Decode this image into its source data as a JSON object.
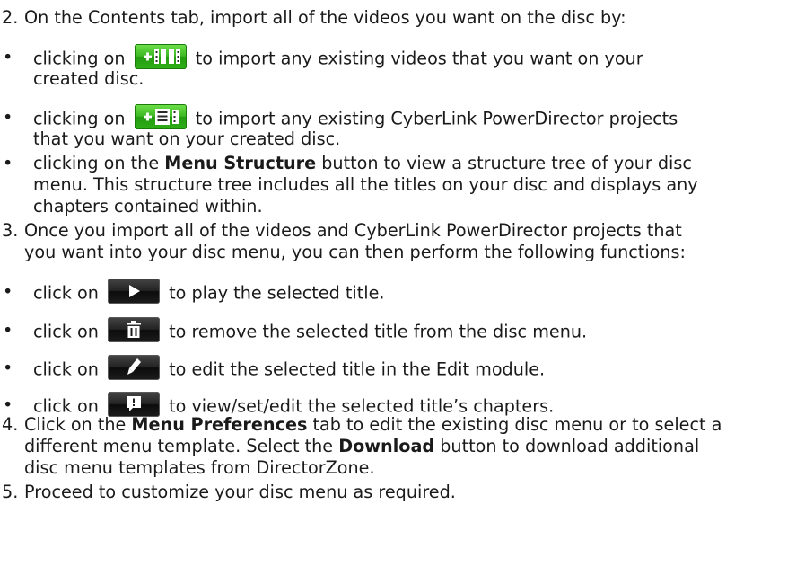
{
  "steps": {
    "step2": {
      "number": "2.",
      "text": "On the Contents tab, import all of the videos you want on the disc by:"
    },
    "bullets_import": [
      {
        "lead": "clicking on",
        "icon": "add-video-icon",
        "line1": "to import any existing videos that you want on your",
        "line2": "created disc."
      },
      {
        "lead": "clicking on",
        "icon": "add-project-icon",
        "line1": "to import any existing CyberLink PowerDirector projects",
        "line2": "that you want on your created disc."
      }
    ],
    "bullet_menu_structure": {
      "lead": "clicking on the ",
      "bold": "Menu Structure",
      "line1_rest": " button to view a structure tree of your disc",
      "line2": "menu. This structure tree includes all the titles on your disc and displays any",
      "line3": "chapters contained within."
    },
    "step3": {
      "number": "3.",
      "line1": "Once you import all of the videos and CyberLink PowerDirector projects that",
      "line2": "you want into your disc menu, you can then perform the following functions:"
    },
    "bullets_functions": [
      {
        "lead": "click on",
        "icon": "play-icon",
        "text": "to play the selected title."
      },
      {
        "lead": "click on",
        "icon": "trash-icon",
        "text": "to remove the selected title from the disc menu."
      },
      {
        "lead": "click on",
        "icon": "pencil-icon",
        "text": "to edit the selected title in the Edit module."
      },
      {
        "lead": "click on",
        "icon": "chapter-icon",
        "text": "to view/set/edit the selected title’s chapters."
      }
    ],
    "step4": {
      "number": "4.",
      "line1_a": "Click on the ",
      "line1_bold": "Menu Preferences",
      "line1_b": " tab to edit the existing disc menu or to select a",
      "line2_a": "different menu template. Select the ",
      "line2_bold": "Download",
      "line2_b": " button to download additional",
      "line3": "disc menu templates from DirectorZone."
    },
    "step5": {
      "number": "5.",
      "text": "Proceed to customize your disc menu as required."
    }
  },
  "bullet_glyph": "•",
  "colors": {
    "text": "#1a1a1a",
    "green_button": "#3cb822",
    "dark_button": "#1c1c1c",
    "icon_white": "#ffffff"
  }
}
